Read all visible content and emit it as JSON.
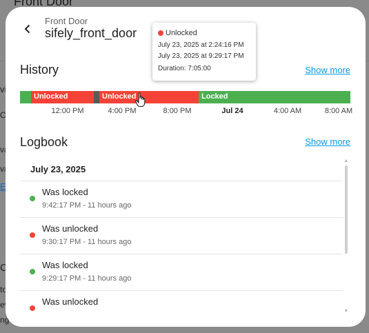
{
  "background": {
    "title_fragment": "Front Door",
    "fragments": [
      "vi",
      "C",
      "va",
      "va",
      "E",
      "C",
      "to",
      "ev",
      "ng"
    ]
  },
  "dialog": {
    "subtitle": "Front Door",
    "title": "sifely_front_door"
  },
  "history": {
    "heading": "History",
    "show_more": "Show more",
    "segments": [
      {
        "state": "Locked",
        "color": "#4caf50",
        "label": ""
      },
      {
        "state": "Unlocked",
        "color": "#f44336",
        "label": "Unlocked"
      },
      {
        "state": "Unknown",
        "color": "#5a5a5a",
        "label": ""
      },
      {
        "state": "Unlocked",
        "color": "#f44336",
        "label": "Unlocked"
      },
      {
        "state": "Locked",
        "color": "#4caf50",
        "label": "Locked"
      }
    ],
    "ticks": [
      {
        "label": "12:00 PM",
        "bold": false
      },
      {
        "label": "4:00 PM",
        "bold": false
      },
      {
        "label": "8:00 PM",
        "bold": false
      },
      {
        "label": "Jul 24",
        "bold": true
      },
      {
        "label": "4:00 AM",
        "bold": false
      },
      {
        "label": "8:00 AM",
        "bold": false
      }
    ]
  },
  "tooltip": {
    "state": "Unlocked",
    "state_color": "#f44336",
    "start": "July 23, 2025 at 2:24:16 PM",
    "end": "July 23, 2025 at 9:29:17 PM",
    "duration": "Duration: 7:05:00"
  },
  "logbook": {
    "heading": "Logbook",
    "show_more": "Show more",
    "date": "July 23, 2025",
    "entries": [
      {
        "message": "Was locked",
        "time": "9:42:17 PM - 11 hours ago",
        "color": "#4caf50"
      },
      {
        "message": "Was unlocked",
        "time": "9:30:17 PM - 11 hours ago",
        "color": "#f44336"
      },
      {
        "message": "Was locked",
        "time": "9:29:17 PM - 11 hours ago",
        "color": "#4caf50"
      },
      {
        "message": "Was unlocked",
        "time": "",
        "color": "#f44336"
      }
    ]
  }
}
